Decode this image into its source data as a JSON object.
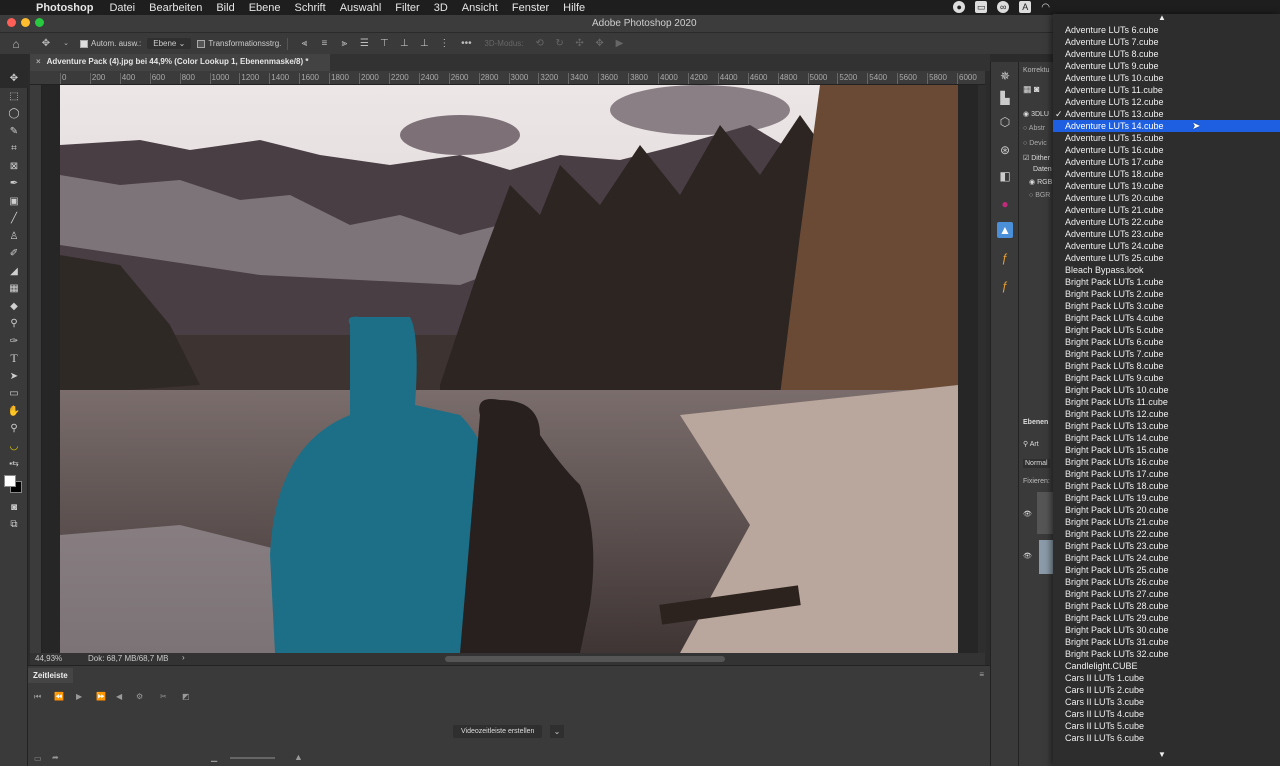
{
  "menubar": {
    "app": "Photoshop",
    "items": [
      "Datei",
      "Bearbeiten",
      "Bild",
      "Ebene",
      "Schrift",
      "Auswahl",
      "Filter",
      "3D",
      "Ansicht",
      "Fenster",
      "Hilfe"
    ]
  },
  "window": {
    "title": "Adobe Photoshop 2020"
  },
  "options": {
    "auto_select_label": "Autom. ausw.:",
    "auto_select_checked": true,
    "auto_select_target": "Ebene",
    "transform_label": "Transformationsstrg.",
    "transform_checked": false,
    "more": "•••",
    "mode3d": "3D-Modus:"
  },
  "document": {
    "tab_title": "Adventure Pack  (4).jpg bei 44,9% (Color Lookup 1, Ebenenmaske/8) *",
    "ruler_ticks": [
      "0",
      "200",
      "400",
      "600",
      "800",
      "1000",
      "1200",
      "1400",
      "1600",
      "1800",
      "2000",
      "2200",
      "2400",
      "2600",
      "2800",
      "3000",
      "3200",
      "3400",
      "3600",
      "3800",
      "4000",
      "4200",
      "4400",
      "4600",
      "4800",
      "5000",
      "5200",
      "5400",
      "5600",
      "5800",
      "6000"
    ],
    "zoom": "44,93%",
    "doc_size": "Dok: 68,7 MB/68,7 MB"
  },
  "timeline": {
    "title": "Zeitleiste",
    "create_button": "Videozeitleiste erstellen"
  },
  "properties": {
    "title": "Korrektu",
    "lut3d": "3DLU",
    "abstract": "Abstr",
    "device": "Devic",
    "dither": "Dither",
    "data_order": "Daten",
    "rgb": "RGB",
    "bgr": "BGR"
  },
  "layers": {
    "title": "Ebenen",
    "search": "Art",
    "blend": "Normal",
    "lock": "Fixieren:"
  },
  "lut_menu": {
    "checked": "Adventure LUTs 13.cube",
    "highlighted": "Adventure LUTs 14.cube",
    "items": [
      "Adventure LUTs 6.cube",
      "Adventure LUTs 7.cube",
      "Adventure LUTs 8.cube",
      "Adventure LUTs 9.cube",
      "Adventure LUTs 10.cube",
      "Adventure LUTs 11.cube",
      "Adventure LUTs 12.cube",
      "Adventure LUTs 13.cube",
      "Adventure LUTs 14.cube",
      "Adventure LUTs 15.cube",
      "Adventure LUTs 16.cube",
      "Adventure LUTs 17.cube",
      "Adventure LUTs 18.cube",
      "Adventure LUTs 19.cube",
      "Adventure LUTs 20.cube",
      "Adventure LUTs 21.cube",
      "Adventure LUTs 22.cube",
      "Adventure LUTs 23.cube",
      "Adventure LUTs 24.cube",
      "Adventure LUTs 25.cube",
      "Bleach Bypass.look",
      "Bright Pack LUTs 1.cube",
      "Bright Pack LUTs 2.cube",
      "Bright Pack LUTs 3.cube",
      "Bright Pack LUTs 4.cube",
      "Bright Pack LUTs 5.cube",
      "Bright Pack LUTs 6.cube",
      "Bright Pack LUTs 7.cube",
      "Bright Pack LUTs 8.cube",
      "Bright Pack LUTs 9.cube",
      "Bright Pack LUTs 10.cube",
      "Bright Pack LUTs 11.cube",
      "Bright Pack LUTs 12.cube",
      "Bright Pack LUTs 13.cube",
      "Bright Pack LUTs 14.cube",
      "Bright Pack LUTs 15.cube",
      "Bright Pack LUTs 16.cube",
      "Bright Pack LUTs 17.cube",
      "Bright Pack LUTs 18.cube",
      "Bright Pack LUTs 19.cube",
      "Bright Pack LUTs 20.cube",
      "Bright Pack LUTs 21.cube",
      "Bright Pack LUTs 22.cube",
      "Bright Pack LUTs 23.cube",
      "Bright Pack LUTs 24.cube",
      "Bright Pack LUTs 25.cube",
      "Bright Pack LUTs 26.cube",
      "Bright Pack LUTs 27.cube",
      "Bright Pack LUTs 28.cube",
      "Bright Pack LUTs 29.cube",
      "Bright Pack LUTs 30.cube",
      "Bright Pack LUTs 31.cube",
      "Bright Pack LUTs 32.cube",
      "Candlelight.CUBE",
      "Cars II LUTs 1.cube",
      "Cars II LUTs 2.cube",
      "Cars II LUTs 3.cube",
      "Cars II LUTs 4.cube",
      "Cars II LUTs 5.cube",
      "Cars II LUTs 6.cube"
    ]
  },
  "colors": {
    "highlight": "#1d5fe0"
  }
}
